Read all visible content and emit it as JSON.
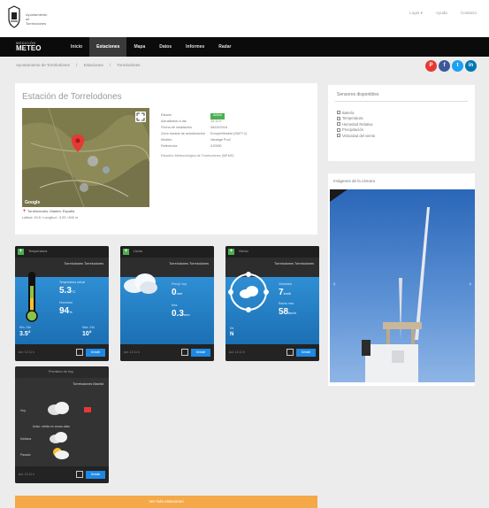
{
  "header": {
    "org_line1": "Ayuntamiento",
    "org_line2": "de",
    "org_line3": "Torrelodones",
    "links": [
      "Login ▾",
      "Ayuda",
      "Contacto"
    ]
  },
  "brand": {
    "small": "MEDICIÓN",
    "big": "METEO"
  },
  "nav": [
    {
      "label": "Inicio",
      "active": false
    },
    {
      "label": "Estaciones",
      "active": true
    },
    {
      "label": "Mapa",
      "active": false
    },
    {
      "label": "Datos",
      "active": false
    },
    {
      "label": "Informes",
      "active": false
    },
    {
      "label": "Radar",
      "active": false
    }
  ],
  "breadcrumb": [
    "Ayuntamiento de Torrelodones",
    "/",
    "Estaciones",
    "/",
    "Torrelodones"
  ],
  "social": [
    {
      "icon": "pinterest-icon",
      "glyph": "P",
      "color": "#e53935"
    },
    {
      "icon": "facebook-icon",
      "glyph": "f",
      "color": "#3b5998"
    },
    {
      "icon": "twitter-icon",
      "glyph": "t",
      "color": "#1da1f2"
    },
    {
      "icon": "linkedin-icon",
      "glyph": "in",
      "color": "#0077b5"
    }
  ],
  "station": {
    "title": "Estación de Torrelodones",
    "map_location": "📍 Torrelodones, Madrid, España",
    "map_coords": "Latitud: 40.5 / Longitud: -3.93 / 845 m",
    "info": [
      {
        "k": "Estado",
        "v": "Activa",
        "badge": true
      },
      {
        "k": "Actualizado a las",
        "v": "12:11 h"
      },
      {
        "k": "Fecha de instalación",
        "v": "06/03/2018"
      },
      {
        "k": "Zona horaria de actualización",
        "v": "Europe/Madrid (GMT+1)"
      },
      {
        "k": "Modelo",
        "v": "Vantage Pro2"
      },
      {
        "k": "Referencia",
        "v": "010550"
      }
    ],
    "note": "Estación Meteorológica de Torrelodones (MEMS)"
  },
  "sensors": {
    "heading": "Sensores disponibles",
    "items": [
      "Batería",
      "Temperatura",
      "Humedad Relativa",
      "Precipitación",
      "Velocidad del viento"
    ]
  },
  "camera": {
    "heading": "Imágenes de la cámara"
  },
  "widgets": {
    "temp": {
      "top": "Temperatura",
      "sub": "Torrelodones Torrelodones",
      "l1": "Temperatura actual",
      "v1": "5.3",
      "u1": "°C",
      "l2": "Humedad",
      "v2": "94",
      "u2": "%",
      "l3": "Mín. 24h",
      "v3": "3.5°",
      "l4": "Máx. 24h",
      "v4": "10°",
      "foot": "Act. 12:11 h",
      "btn": "Detalle"
    },
    "rain": {
      "top": "Lluvia",
      "sub": "Torrelodones Torrelodones",
      "l1": "Precip. hoy",
      "v1": "0",
      "u1": "mm",
      "l2": "Mes",
      "v2": "0.3",
      "u2": "mm",
      "foot": "Act. 12:11 h",
      "btn": "Detalle"
    },
    "wind": {
      "top": "Viento",
      "sub": "Torrelodones Torrelodones",
      "l1": "Velocidad",
      "v1": "7",
      "u1": "km/h",
      "l2": "Racha máx.",
      "v2": "58",
      "u2": "km/h",
      "l3": "Dir.",
      "v3": "N",
      "foot": "Act. 12:11 h",
      "btn": "Detalle"
    },
    "forecast": {
      "top": "Previsión de hoy",
      "sub": "Torrelodones Madrid",
      "r1": "Hoy",
      "r2": "Mañana",
      "r3": "Pasado",
      "label": "Aviso: niebla en zonas altas",
      "foot": "Act. 12:11 h",
      "btn": "Detalle"
    }
  },
  "cta": "Ver más estaciones",
  "colors": {
    "accent": "#1e88e5",
    "green": "#4caf50",
    "orange": "#f4a847"
  }
}
